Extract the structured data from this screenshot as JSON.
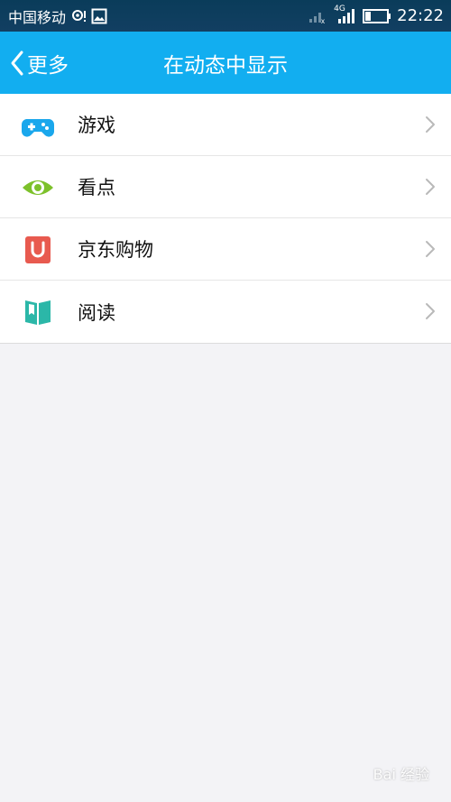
{
  "status_bar": {
    "carrier": "中国移动",
    "network": "4G",
    "time": "22:22"
  },
  "nav": {
    "back_label": "更多",
    "title": "在动态中显示"
  },
  "items": [
    {
      "label": "游戏",
      "icon": "game-controller-icon",
      "color": "#1aa7ec"
    },
    {
      "label": "看点",
      "icon": "eye-icon",
      "color": "#7dc12b"
    },
    {
      "label": "京东购物",
      "icon": "shopping-bag-icon",
      "color": "#e85a4f"
    },
    {
      "label": "阅读",
      "icon": "book-icon",
      "color": "#2bb7a8"
    }
  ],
  "watermark": "Bai 经验"
}
